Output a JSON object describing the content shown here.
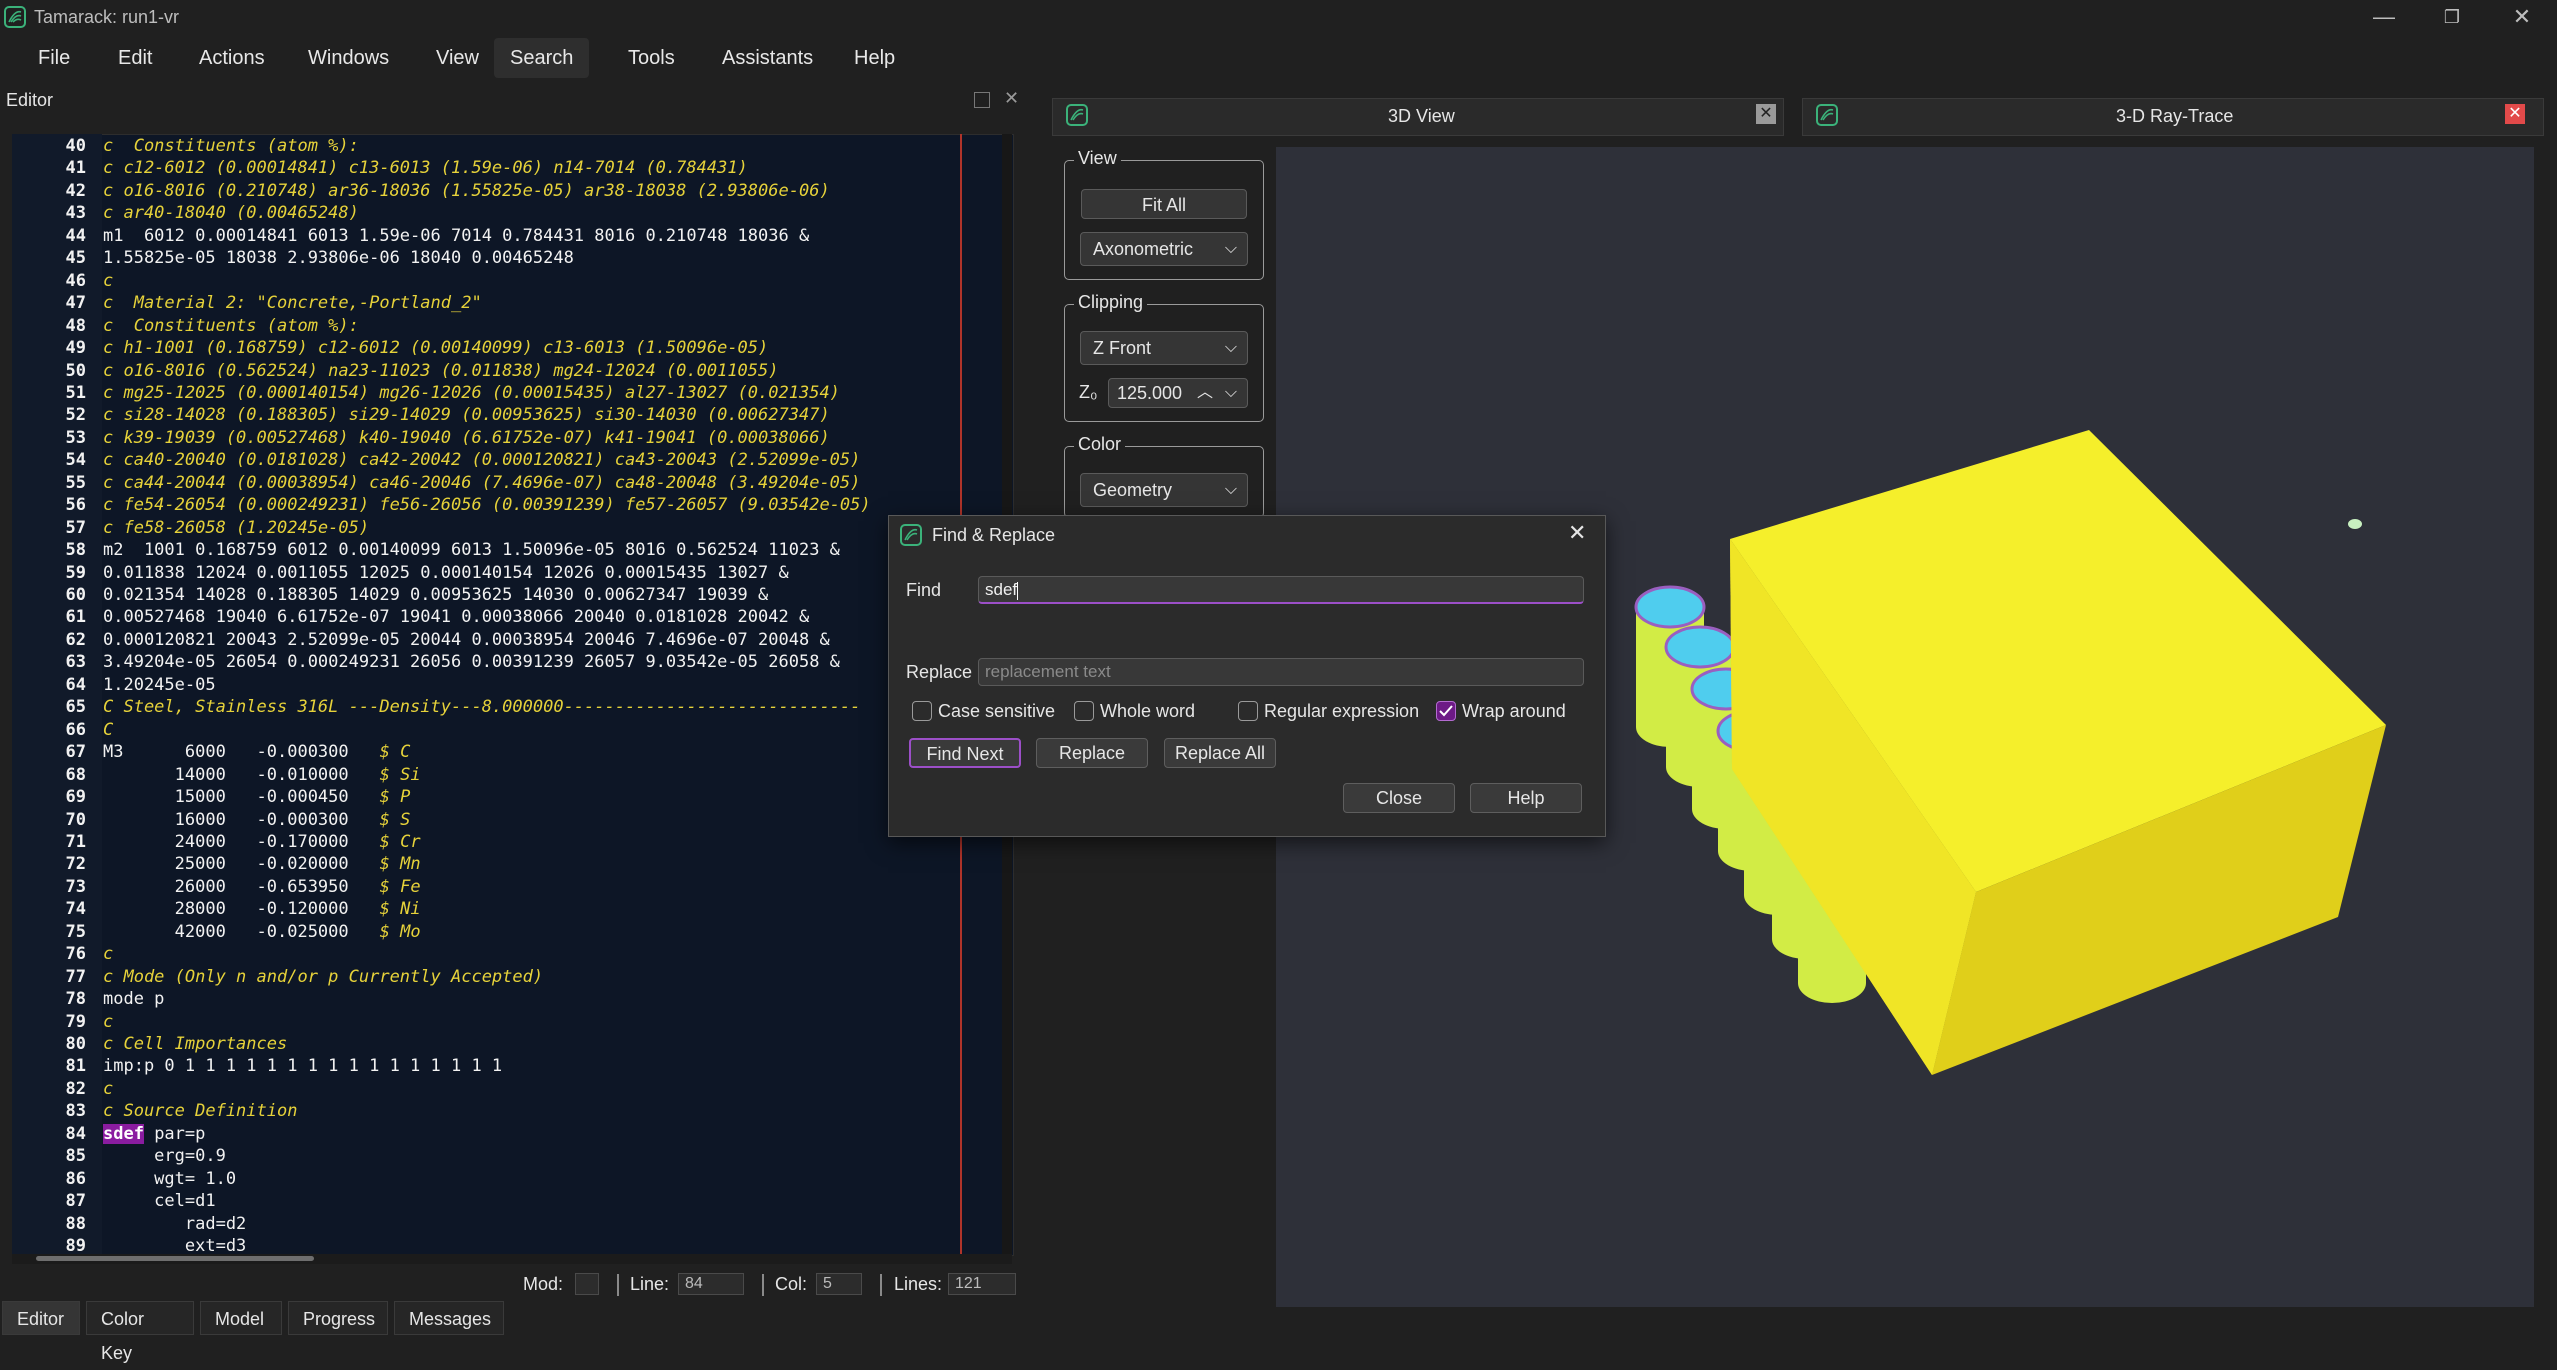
{
  "window": {
    "title": "Tamarack: run1-vr",
    "minimize_glyph": "—",
    "maximize_glyph": "❐",
    "close_glyph": "✕"
  },
  "menu": [
    "File",
    "Edit",
    "Actions",
    "Windows",
    "View",
    "Search",
    "Tools",
    "Assistants",
    "Help"
  ],
  "menu_active": "Search",
  "editor": {
    "panel_title": "Editor",
    "lines": [
      {
        "n": "40",
        "text": "c  Constituents (atom %):",
        "style": "comment"
      },
      {
        "n": "41",
        "text": "c c12-6012 (0.00014841) c13-6013 (1.59e-06) n14-7014 (0.784431)",
        "style": "comment"
      },
      {
        "n": "42",
        "text": "c o16-8016 (0.210748) ar36-18036 (1.55825e-05) ar38-18038 (2.93806e-06)",
        "style": "comment"
      },
      {
        "n": "43",
        "text": "c ar40-18040 (0.00465248)",
        "style": "comment"
      },
      {
        "n": "44",
        "text": "m1  6012 0.00014841 6013 1.59e-06 7014 0.784431 8016 0.210748 18036 &",
        "style": "plain"
      },
      {
        "n": "45",
        "text": "1.55825e-05 18038 2.93806e-06 18040 0.00465248",
        "style": "plain"
      },
      {
        "n": "46",
        "text": "c",
        "style": "comment"
      },
      {
        "n": "47",
        "text": "c  Material 2: \"Concrete,-Portland_2\"",
        "style": "comment"
      },
      {
        "n": "48",
        "text": "c  Constituents (atom %):",
        "style": "comment"
      },
      {
        "n": "49",
        "text": "c h1-1001 (0.168759) c12-6012 (0.00140099) c13-6013 (1.50096e-05)",
        "style": "comment"
      },
      {
        "n": "50",
        "text": "c o16-8016 (0.562524) na23-11023 (0.011838) mg24-12024 (0.0011055)",
        "style": "comment"
      },
      {
        "n": "51",
        "text": "c mg25-12025 (0.000140154) mg26-12026 (0.00015435) al27-13027 (0.021354)",
        "style": "comment"
      },
      {
        "n": "52",
        "text": "c si28-14028 (0.188305) si29-14029 (0.00953625) si30-14030 (0.00627347)",
        "style": "comment"
      },
      {
        "n": "53",
        "text": "c k39-19039 (0.00527468) k40-19040 (6.61752e-07) k41-19041 (0.00038066)",
        "style": "comment"
      },
      {
        "n": "54",
        "text": "c ca40-20040 (0.0181028) ca42-20042 (0.000120821) ca43-20043 (2.52099e-05)",
        "style": "comment"
      },
      {
        "n": "55",
        "text": "c ca44-20044 (0.00038954) ca46-20046 (7.4696e-07) ca48-20048 (3.49204e-05)",
        "style": "comment"
      },
      {
        "n": "56",
        "text": "c fe54-26054 (0.000249231) fe56-26056 (0.00391239) fe57-26057 (9.03542e-05)",
        "style": "comment"
      },
      {
        "n": "57",
        "text": "c fe58-26058 (1.20245e-05)",
        "style": "comment"
      },
      {
        "n": "58",
        "text": "m2  1001 0.168759 6012 0.00140099 6013 1.50096e-05 8016 0.562524 11023 &",
        "style": "plain"
      },
      {
        "n": "59",
        "text": "0.011838 12024 0.0011055 12025 0.000140154 12026 0.00015435 13027 &",
        "style": "plain"
      },
      {
        "n": "60",
        "text": "0.021354 14028 0.188305 14029 0.00953625 14030 0.00627347 19039 &",
        "style": "plain"
      },
      {
        "n": "61",
        "text": "0.00527468 19040 6.61752e-07 19041 0.00038066 20040 0.0181028 20042 &",
        "style": "plain"
      },
      {
        "n": "62",
        "text": "0.000120821 20043 2.52099e-05 20044 0.00038954 20046 7.4696e-07 20048 &",
        "style": "plain"
      },
      {
        "n": "63",
        "text": "3.49204e-05 26054 0.000249231 26056 0.00391239 26057 9.03542e-05 26058 &",
        "style": "plain"
      },
      {
        "n": "64",
        "text": "1.20245e-05",
        "style": "plain"
      },
      {
        "n": "65",
        "text": "C Steel, Stainless 316L ---Density---8.000000-----------------------------",
        "style": "comment"
      },
      {
        "n": "66",
        "text": "C",
        "style": "comment"
      },
      {
        "n": "67",
        "text": "M3      6000   -0.000300",
        "comment": "$ C",
        "style": "mat"
      },
      {
        "n": "68",
        "text": "       14000   -0.010000",
        "comment": "$ Si",
        "style": "mat"
      },
      {
        "n": "69",
        "text": "       15000   -0.000450",
        "comment": "$ P",
        "style": "mat"
      },
      {
        "n": "70",
        "text": "       16000   -0.000300",
        "comment": "$ S",
        "style": "mat"
      },
      {
        "n": "71",
        "text": "       24000   -0.170000",
        "comment": "$ Cr",
        "style": "mat"
      },
      {
        "n": "72",
        "text": "       25000   -0.020000",
        "comment": "$ Mn",
        "style": "mat"
      },
      {
        "n": "73",
        "text": "       26000   -0.653950",
        "comment": "$ Fe",
        "style": "mat"
      },
      {
        "n": "74",
        "text": "       28000   -0.120000",
        "comment": "$ Ni",
        "style": "mat"
      },
      {
        "n": "75",
        "text": "       42000   -0.025000",
        "comment": "$ Mo",
        "style": "mat"
      },
      {
        "n": "76",
        "text": "c",
        "style": "comment"
      },
      {
        "n": "77",
        "text": "c Mode (Only n and/or p Currently Accepted)",
        "style": "comment"
      },
      {
        "n": "78",
        "text": "mode p",
        "style": "plain"
      },
      {
        "n": "79",
        "text": "c",
        "style": "comment"
      },
      {
        "n": "80",
        "text": "c Cell Importances",
        "style": "comment"
      },
      {
        "n": "81",
        "text": "imp:p 0 1 1 1 1 1 1 1 1 1 1 1 1 1 1 1 1",
        "style": "plain"
      },
      {
        "n": "82",
        "text": "c",
        "style": "comment"
      },
      {
        "n": "83",
        "text": "c Source Definition",
        "style": "comment"
      },
      {
        "n": "84",
        "text": " par=p",
        "highlight": "sdef",
        "style": "hl"
      },
      {
        "n": "85",
        "text": "     erg=0.9",
        "style": "plain"
      },
      {
        "n": "86",
        "text": "     wgt= 1.0",
        "style": "plain"
      },
      {
        "n": "87",
        "text": "     cel=d1",
        "style": "plain"
      },
      {
        "n": "88",
        "text": "        rad=d2",
        "style": "plain"
      },
      {
        "n": "89",
        "text": "        ext=d3",
        "style": "plain"
      }
    ]
  },
  "status": {
    "mod_label": "Mod:",
    "mod_value": "",
    "line_label": "Line:",
    "line_value": "84",
    "col_label": "Col:",
    "col_value": "5",
    "lines_label": "Lines:",
    "lines_value": "121"
  },
  "bottom_tabs": [
    "Editor",
    "Color Key",
    "Model",
    "Progress",
    "Messages"
  ],
  "bottom_tab_active": "Editor",
  "view_tabs": [
    {
      "label": "3D View",
      "close_color": "#9a9a9a"
    },
    {
      "label": "3-D Ray-Trace",
      "close_color": "#e24a4a"
    }
  ],
  "controls": {
    "view_group": "View",
    "fit_all": "Fit All",
    "projection": "Axonometric",
    "clipping_group": "Clipping",
    "clip_plane": "Z Front",
    "z0_label": "Z₀",
    "z0_value": "125.000",
    "color_group": "Color",
    "color_mode": "Geometry"
  },
  "dialog": {
    "title": "Find & Replace",
    "find_label": "Find",
    "find_value": "sdef",
    "replace_label": "Replace",
    "replace_placeholder": "replacement text",
    "options": [
      {
        "label": "Case sensitive",
        "checked": false
      },
      {
        "label": "Whole word",
        "checked": false
      },
      {
        "label": "Regular expression",
        "checked": false
      },
      {
        "label": "Wrap around",
        "checked": true
      }
    ],
    "find_next": "Find Next",
    "replace": "Replace",
    "replace_all": "Replace All",
    "close": "Close",
    "help": "Help"
  },
  "colors": {
    "accent": "#9c4fc8",
    "comment_text": "#e6d23a",
    "box_yellow": "#f2ea2a",
    "cylinder_green": "#d8f24a",
    "cylinder_top": "#4fd2f0"
  }
}
